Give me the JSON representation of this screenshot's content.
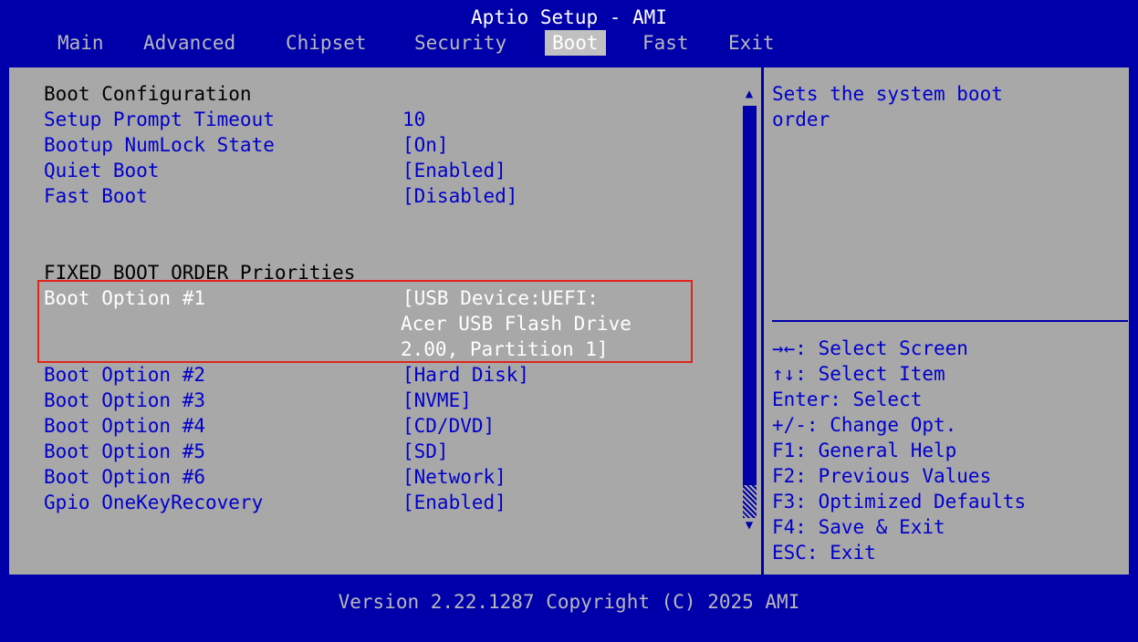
{
  "window": {
    "title": "Aptio Setup - AMI"
  },
  "tabs": [
    {
      "label": "Main"
    },
    {
      "label": "Advanced"
    },
    {
      "label": "Chipset"
    },
    {
      "label": "Security"
    },
    {
      "label": "Boot",
      "active": true
    },
    {
      "label": "Fast"
    },
    {
      "label": "Exit"
    }
  ],
  "boot": {
    "config_heading": "Boot Configuration",
    "settings": [
      {
        "label": "Setup Prompt Timeout",
        "value": "10"
      },
      {
        "label": "Bootup NumLock State",
        "value": "[On]"
      },
      {
        "label": "Quiet Boot",
        "value": "[Enabled]"
      },
      {
        "label": "Fast Boot",
        "value": "[Disabled]"
      }
    ],
    "priorities_heading": "FIXED BOOT ORDER Priorities",
    "selected_option": {
      "label": "Boot Option #1",
      "value_lines": [
        "[USB Device:UEFI:",
        "Acer USB Flash Drive",
        "2.00, Partition 1]"
      ]
    },
    "options": [
      {
        "label": "Boot Option #2",
        "value": "[Hard Disk]"
      },
      {
        "label": "Boot Option #3",
        "value": "[NVME]"
      },
      {
        "label": "Boot Option #4",
        "value": "[CD/DVD]"
      },
      {
        "label": "Boot Option #5",
        "value": "[SD]"
      },
      {
        "label": "Boot Option #6",
        "value": "[Network]"
      },
      {
        "label": "Gpio OneKeyRecovery",
        "value": "[Enabled]"
      }
    ]
  },
  "help": {
    "description_lines": [
      "Sets the system boot",
      "order"
    ],
    "keys": [
      "→←: Select Screen",
      "↑↓: Select Item",
      "Enter: Select",
      "+/-: Change Opt.",
      "F1: General Help",
      "F2: Previous Values",
      "F3: Optimized Defaults",
      "F4: Save & Exit",
      "ESC: Exit"
    ]
  },
  "footer": {
    "text": "Version 2.22.1287 Copyright (C) 2025 AMI"
  },
  "icons": {
    "scroll_up": "▲",
    "scroll_down": "▼"
  },
  "colors": {
    "background": "#0000aa",
    "panel": "#a8a8a8",
    "text": "#0000cc",
    "highlight": "#ffffff",
    "selection_box": "#e0241c"
  }
}
